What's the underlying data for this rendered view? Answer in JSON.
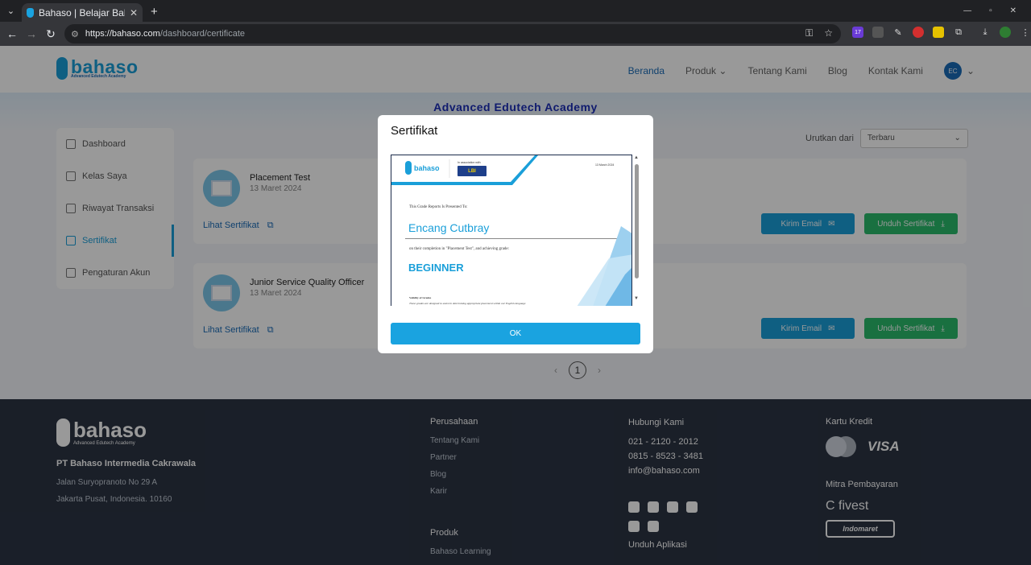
{
  "browser": {
    "tab_title": "Bahaso | Belajar Bahasa",
    "url_host": "https://bahaso.com",
    "url_path": "/dashboard/certificate",
    "ext_badge": "17"
  },
  "header": {
    "logo_text": "bahaso",
    "logo_sub": "Advanced Edutech Academy",
    "nav": [
      "Beranda",
      "Produk",
      "Tentang Kami",
      "Blog",
      "Kontak Kami"
    ],
    "avatar_initials": "EC"
  },
  "banner": {
    "title": "Advanced Edutech Academy"
  },
  "sidebar": {
    "items": [
      "Dashboard",
      "Kelas Saya",
      "Riwayat Transaksi",
      "Sertifikat",
      "Pengaturan Akun"
    ]
  },
  "sort": {
    "label": "Urutkan dari",
    "value": "Terbaru"
  },
  "certificates": [
    {
      "title": "Placement Test",
      "date": "13 Maret 2024",
      "link": "Lihat Sertifikat",
      "email": "Kirim Email",
      "download": "Unduh Sertifikat"
    },
    {
      "title": "Junior Service Quality Officer",
      "date": "13 Maret 2024",
      "link": "Lihat Sertifikat",
      "email": "Kirim Email",
      "download": "Unduh Sertifikat"
    }
  ],
  "pagination": {
    "current": "1"
  },
  "footer": {
    "logo_text": "bahaso",
    "logo_sub": "Advanced Edutech Academy",
    "company": "PT Bahaso Intermedia Cakrawala",
    "address1": "Jalan Suryopranoto No 29 A",
    "address2": "Jakarta Pusat, Indonesia. 10160",
    "perusahaan_heading": "Perusahaan",
    "perusahaan": [
      "Tentang Kami",
      "Partner",
      "Blog",
      "Karir"
    ],
    "produk_heading": "Produk",
    "produk": [
      "Bahaso Learning"
    ],
    "hubungi_heading": "Hubungi Kami",
    "phone1": "021 - 2120 - 2012",
    "phone2": "0815 - 8523 - 3481",
    "email": "info@bahaso.com",
    "unduh_heading": "Unduh Aplikasi",
    "kartu_heading": "Kartu Kredit",
    "mitra_heading": "Mitra Pembayaran",
    "visa": "VISA",
    "mastercard": "mastercard",
    "ovo": "C fivest",
    "indomaret": "Indomaret"
  },
  "modal": {
    "title": "Sertifikat",
    "ok_label": "OK",
    "certificate": {
      "logo": "bahaso",
      "assoc": "In association with",
      "partner": "LBI",
      "date": "13 March 2024",
      "presented": "This Grade Reports Is Presented To:",
      "name": "Encang Cutbray",
      "completion": "on their completion in \"Placement Test\", and achieving grade:",
      "grade": "BEGINNER",
      "validity_heading": "Validity of Grades",
      "validity_text": "These grades are designed to assist in determining appropriate placement within our English language"
    }
  }
}
